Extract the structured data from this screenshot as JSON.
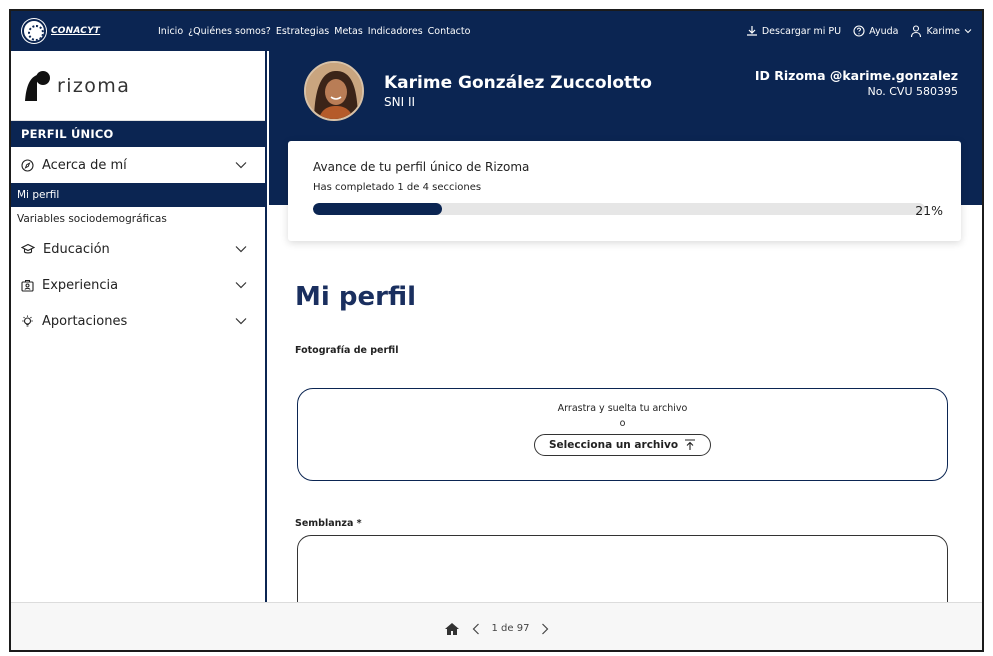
{
  "window": {
    "top_fragment": ""
  },
  "topbar": {
    "logo_text": "CONACYT",
    "nav": [
      "Inicio",
      "¿Quiénes somos?",
      "Estrategias",
      "Metas",
      "Indicadores",
      "Contacto"
    ],
    "download_label": "Descargar mi PU",
    "help_label": "Ayuda",
    "user_label": "Karime"
  },
  "sidebar": {
    "brand": "rizoma",
    "section_title": "PERFIL ÚNICO",
    "items": [
      {
        "label": "Acerca de mí",
        "icon": "compass-icon"
      },
      {
        "label": "Educación",
        "icon": "graduation-cap-icon"
      },
      {
        "label": "Experiencia",
        "icon": "badge-icon"
      },
      {
        "label": "Aportaciones",
        "icon": "lightbulb-icon"
      }
    ],
    "subitems": [
      {
        "label": "Mi perfil",
        "active": true
      },
      {
        "label": "Variables sociodemográficas",
        "active": false
      }
    ]
  },
  "profile": {
    "name": "Karime González Zuccolotto",
    "level": "SNI II",
    "id_label": "ID Rizoma @karime.gonzalez",
    "cvu_label": "No. CVU 580395"
  },
  "progress": {
    "title": "Avance de tu perfil único de Rizoma",
    "subtitle": "Has completado 1 de 4 secciones",
    "percent_label": "21%",
    "fraction": 0.21
  },
  "content": {
    "page_title": "Mi perfil",
    "photo_label": "Fotografía de perfil",
    "drop_text": "Arrastra y suelta tu archivo",
    "drop_or": "o",
    "select_button": "Selecciona un archivo",
    "semblanza_label": "Semblanza *"
  },
  "pager": {
    "label": "1 de 97"
  },
  "colors": {
    "primary": "#0b2552",
    "accent_text": "#1a2f5f"
  }
}
